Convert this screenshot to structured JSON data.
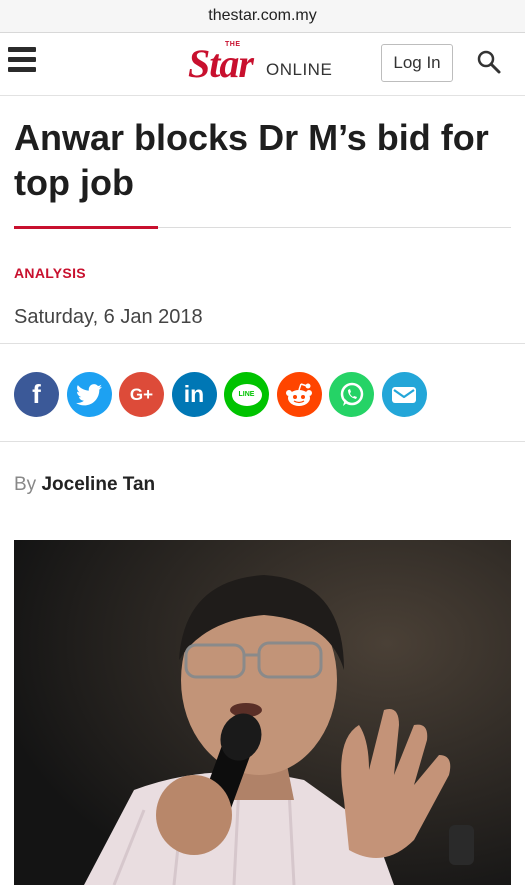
{
  "browser": {
    "url": "thestar.com.my"
  },
  "header": {
    "logo_the": "THE",
    "logo_star": "Star",
    "logo_online": "ONLINE",
    "login_label": "Log In"
  },
  "article": {
    "headline": "Anwar blocks Dr M’s bid for top job",
    "kicker": "ANALYSIS",
    "date": "Saturday, 6 Jan 2018",
    "byline_prefix": "By",
    "author": "Joceline Tan"
  },
  "share": [
    {
      "name": "facebook",
      "icon": "facebook-icon",
      "color": "#3b5998",
      "glyph": "f"
    },
    {
      "name": "twitter",
      "icon": "twitter-icon",
      "color": "#1da1f2",
      "glyph": ""
    },
    {
      "name": "google-plus",
      "icon": "google-plus-icon",
      "color": "#dd4b39",
      "glyph": "G+"
    },
    {
      "name": "linkedin",
      "icon": "linkedin-icon",
      "color": "#0077b5",
      "glyph": "in"
    },
    {
      "name": "line",
      "icon": "line-icon",
      "color": "#00c300",
      "glyph": "LINE"
    },
    {
      "name": "reddit",
      "icon": "reddit-icon",
      "color": "#ff4500",
      "glyph": ""
    },
    {
      "name": "whatsapp",
      "icon": "whatsapp-icon",
      "color": "#25d366",
      "glyph": ""
    },
    {
      "name": "email",
      "icon": "email-icon",
      "color": "#23a6d8",
      "glyph": ""
    }
  ],
  "colors": {
    "brand_red": "#c8102e"
  }
}
